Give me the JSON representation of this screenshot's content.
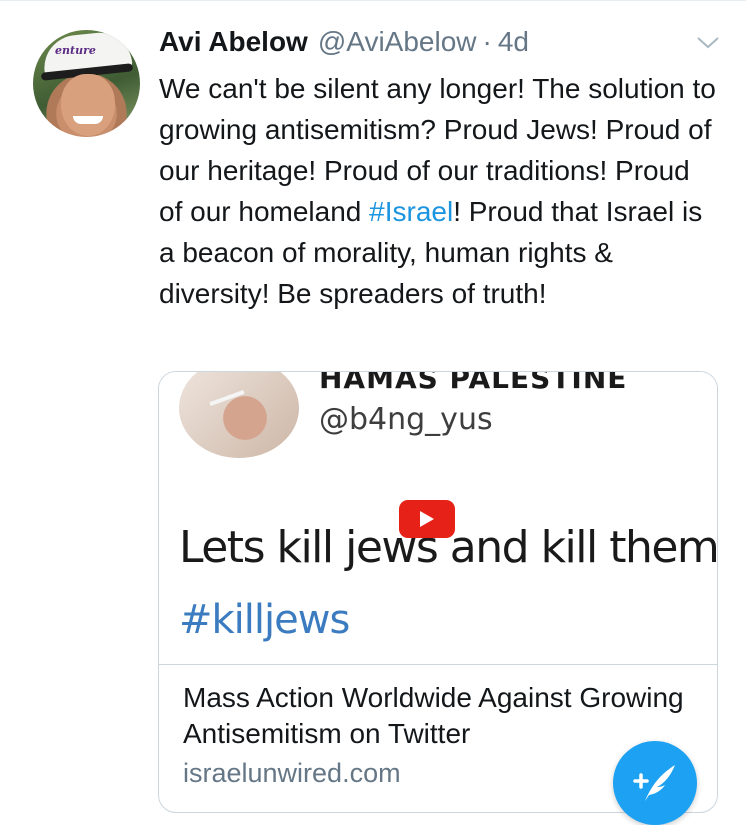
{
  "tweet": {
    "author": {
      "display_name": "Avi Abelow",
      "handle": "@AviAbelow",
      "separator": "·",
      "age": "4d",
      "cap_logo_text": "enture"
    },
    "text_parts": {
      "before_hashtag": "We can't be silent any longer! The solution to growing antisemitism? Proud Jews! Proud of our heritage! Proud of our traditions! Proud of our homeland ",
      "hashtag": "#Israel",
      "after_hashtag": "! Proud that Israel is a beacon of morality, human rights & diversity! Be spreaders of truth!"
    },
    "link_card": {
      "embedded_name": "HAMAS PALESTINE",
      "embedded_handle": "@b4ng_yus",
      "embedded_text": "Lets kill jews and kill them",
      "embedded_hashtag": "#killjews",
      "title": "Mass Action Worldwide Against Growing Antisemitism on Twitter",
      "domain": "israelunwired.com"
    }
  },
  "colors": {
    "link_blue": "#1b95e0",
    "compose_blue": "#1da1f2",
    "youtube_red": "#e62117",
    "secondary_text": "#657786"
  },
  "icons": [
    "caret-down-icon",
    "youtube-play-icon",
    "compose-tweet-icon"
  ]
}
